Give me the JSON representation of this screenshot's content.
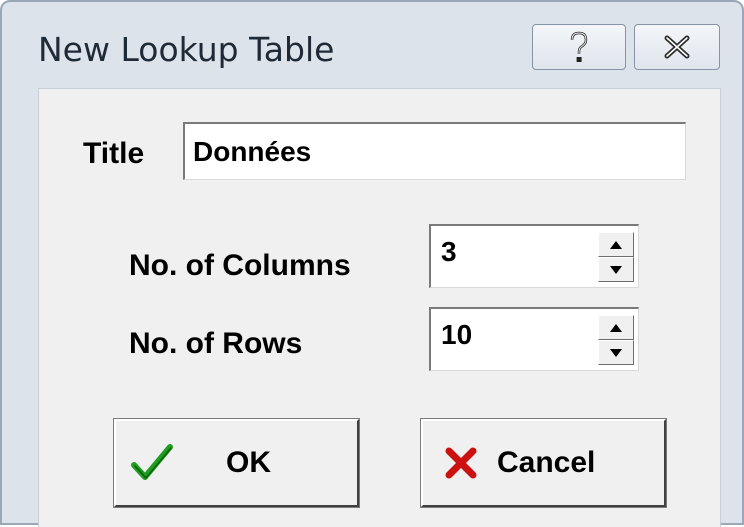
{
  "window": {
    "title": "New Lookup Table",
    "help_glyph": "?",
    "close_glyph": "✕"
  },
  "form": {
    "title_label": "Title",
    "title_value": "Données",
    "columns_label": "No. of Columns",
    "columns_value": "3",
    "rows_label": "No. of Rows",
    "rows_value": "10"
  },
  "buttons": {
    "ok_label": "OK",
    "cancel_label": "Cancel"
  },
  "colors": {
    "ok_check": "#1e9e1e",
    "cancel_x": "#cc1111"
  },
  "icons": {
    "help": "question-mark-icon",
    "close": "close-icon",
    "ok": "checkmark-icon",
    "cancel": "x-icon",
    "spin_up": "arrow-up-icon",
    "spin_down": "arrow-down-icon"
  }
}
